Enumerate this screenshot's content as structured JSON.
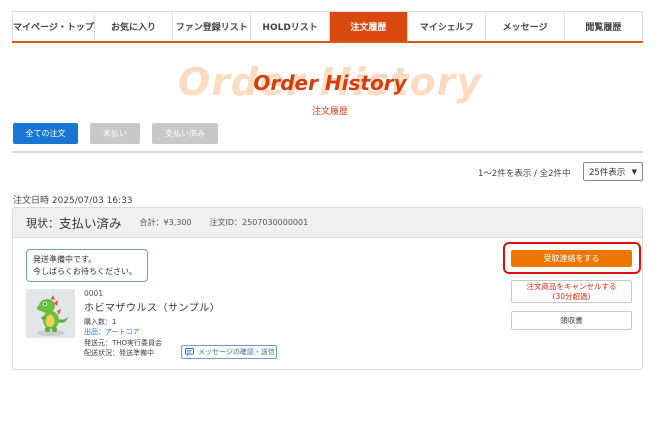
{
  "nav": {
    "items": [
      {
        "label": "マイページ・トップ",
        "active": false
      },
      {
        "label": "お気に入り",
        "active": false
      },
      {
        "label": "ファン登録リスト",
        "active": false
      },
      {
        "label": "HOLDリスト",
        "active": false
      },
      {
        "label": "注文履歴",
        "active": true
      },
      {
        "label": "マイシェルフ",
        "active": false
      },
      {
        "label": "メッセージ",
        "active": false
      },
      {
        "label": "閲覧履歴",
        "active": false
      }
    ]
  },
  "heading": {
    "background_text": "Order History",
    "title": "Order History",
    "subtitle": "注文履歴"
  },
  "filters": {
    "all": "全ての注文",
    "unpaid": "未払い",
    "paid": "支払い済み"
  },
  "paging": {
    "count_text": "1～2件を表示 / 全2件中",
    "per_page": "25件表示"
  },
  "order": {
    "date_text": "注文日時 2025/07/03 16:33",
    "status_label": "現状：",
    "status_value": "支払い済み",
    "total": "合計：¥3,300",
    "order_id": "注文ID：2507030000001",
    "notice_line1": "発送準備中です。",
    "notice_line2": "今しばらくお待ちください。",
    "receive_button": "受取連絡をする",
    "cancel_button_line1": "注文商品をキャンセルする",
    "cancel_button_line2": "(30分超過)",
    "receipt_button": "領収書",
    "item": {
      "number": "0001",
      "name": "ホビマザウルス（サンプル）",
      "quantity": "購入数：1",
      "seller_label": "出品：",
      "seller_name": "アートコア",
      "ship_from": "発送元：THO実行委員会",
      "delivery_status": "配送状況：発送準備中",
      "message_button": "メッセージの確認・送信"
    }
  },
  "colors": {
    "accent": "#d9480f",
    "primary": "#1976d2",
    "receive_button": "#ee7700",
    "highlight": "#e01010"
  }
}
